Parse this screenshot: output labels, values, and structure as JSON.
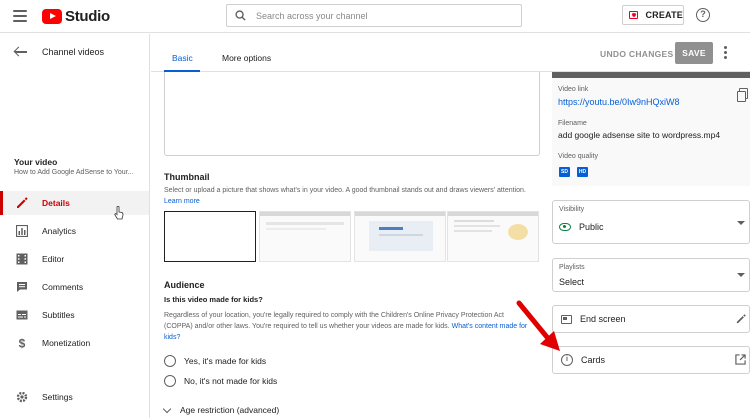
{
  "app": {
    "logo_text": "Studio"
  },
  "topbar": {
    "search_placeholder": "Search across your channel",
    "create_label": "CREATE",
    "help_glyph": "?"
  },
  "sidebar": {
    "back_label": "Channel videos",
    "your_video_label": "Your video",
    "video_title": "How to Add Google AdSense to Your...",
    "items": [
      {
        "label": "Details",
        "icon": "pencil-icon",
        "active": true
      },
      {
        "label": "Analytics",
        "icon": "analytics-icon"
      },
      {
        "label": "Editor",
        "icon": "film-icon"
      },
      {
        "label": "Comments",
        "icon": "comment-icon"
      },
      {
        "label": "Subtitles",
        "icon": "subtitles-icon"
      },
      {
        "label": "Monetization",
        "icon": "dollar-icon"
      }
    ],
    "settings_label": "Settings"
  },
  "tabs": [
    {
      "label": "Basic",
      "active": true
    },
    {
      "label": "More options"
    }
  ],
  "actions": {
    "undo": "UNDO CHANGES",
    "save": "SAVE"
  },
  "thumbnail": {
    "title": "Thumbnail",
    "description": "Select or upload a picture that shows what's in your video. A good thumbnail stands out and draws viewers' attention.",
    "learn_more": "Learn more"
  },
  "audience": {
    "title": "Audience",
    "question": "Is this video made for kids?",
    "description": "Regardless of your location, you're legally required to comply with the Children's Online Privacy Protection Act (COPPA) and/or other laws. You're required to tell us whether your videos are made for kids.",
    "link": "What's content made for kids?",
    "options": [
      "Yes, it's made for kids",
      "No, it's not made for kids"
    ],
    "age_restriction": "Age restriction (advanced)"
  },
  "video_info": {
    "link_label": "Video link",
    "link": "https://youtu.be/0Iw9nHQxiW8",
    "filename_label": "Filename",
    "filename": "add google adsense site to wordpress.mp4",
    "quality_label": "Video quality",
    "quality_badges": [
      "SD",
      "HD"
    ]
  },
  "visibility": {
    "label": "Visibility",
    "value": "Public"
  },
  "playlists": {
    "label": "Playlists",
    "value": "Select"
  },
  "end_screen": {
    "label": "End screen"
  },
  "cards": {
    "label": "Cards",
    "glyph": "i"
  },
  "colors": {
    "accent": "#065fd4",
    "brand": "#ff0000",
    "active_nav": "#cc0000",
    "public": "#0b8043"
  }
}
